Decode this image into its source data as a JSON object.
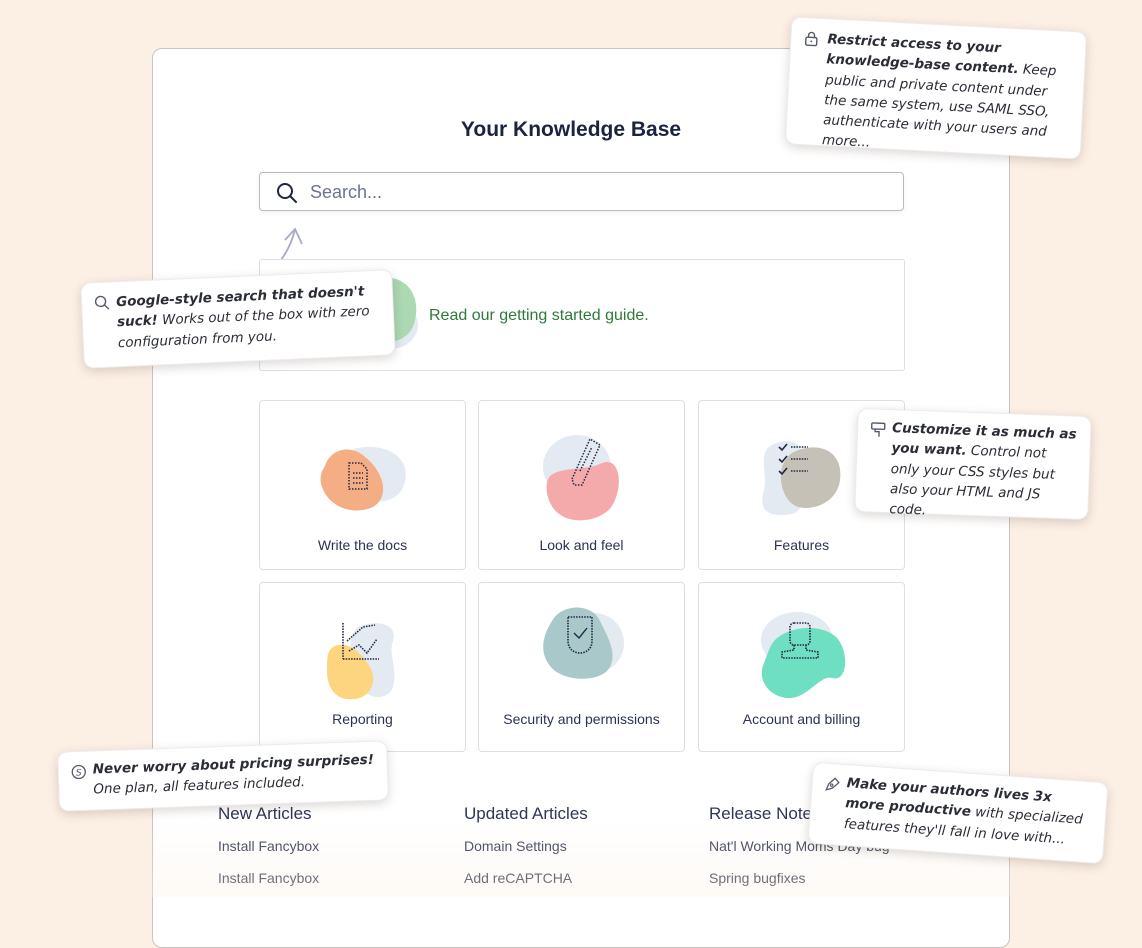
{
  "page": {
    "title": "Your Knowledge Base",
    "search": {
      "placeholder": "Search...",
      "value": ""
    },
    "guide_link": "Read our getting started guide.",
    "categories": [
      {
        "label": "Write the docs",
        "icon": "document-icon",
        "color": "#f5ad84"
      },
      {
        "label": "Look and feel",
        "icon": "pencil-icon",
        "color": "#f4aaab"
      },
      {
        "label": "Features",
        "icon": "checklist-icon",
        "color": "#c6c1b6"
      },
      {
        "label": "Reporting",
        "icon": "chart-icon",
        "color": "#fdd57e"
      },
      {
        "label": "Security and permissions",
        "icon": "shield-check-icon",
        "color": "#a8c8c9"
      },
      {
        "label": "Account and billing",
        "icon": "user-icon",
        "color": "#6fdfc1"
      }
    ],
    "columns": [
      {
        "heading": "New Articles",
        "items": [
          "Install Fancybox",
          "Install Fancybox"
        ]
      },
      {
        "heading": "Updated Articles",
        "items": [
          "Domain Settings",
          "Add reCAPTCHA"
        ]
      },
      {
        "heading": "Release Notes",
        "items": [
          "Nat'l Working Moms Day bug",
          "Spring bugfixes"
        ]
      }
    ]
  },
  "callouts": {
    "access": {
      "icon": "lock-icon",
      "bold": "Restrict access to your knowledge-base content.",
      "text": " Keep public and private content under the same system, use SAML SSO, authenticate with your users and more..."
    },
    "search": {
      "icon": "search-icon",
      "bold": "Google-style search that doesn't suck!",
      "text": " Works out of the box with zero configuration from you."
    },
    "customize": {
      "icon": "paint-roller-icon",
      "bold": "Customize it as much as you want.",
      "text": " Control not only your CSS styles but also your HTML and JS code."
    },
    "pricing": {
      "icon": "dollar-icon",
      "bold": "Never worry about pricing surprises!",
      "text": "One plan, all features included."
    },
    "authors": {
      "icon": "pen-nib-icon",
      "bold": "Make your authors lives 3x more productive",
      "text": " with specialized features they'll fall in love with..."
    }
  },
  "colors": {
    "background": "#fcefe4",
    "title": "#1c2340",
    "guide_link": "#2e7a3b",
    "blob_neutral": "#e3eaf2"
  }
}
